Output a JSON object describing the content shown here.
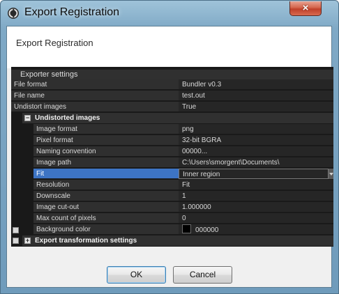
{
  "window": {
    "title": "Export Registration",
    "close_glyph": "×"
  },
  "header": {
    "title": "Export Registration"
  },
  "grid": {
    "group_title": "Exporter settings",
    "top_rows": [
      {
        "label": "File format",
        "value": "Bundler v0.3"
      },
      {
        "label": "File name",
        "value": "test.out"
      },
      {
        "label": "Undistort images",
        "value": "True"
      }
    ],
    "undistorted_section": {
      "label": "Undistorted images",
      "expander": "−"
    },
    "sub_rows": [
      {
        "label": "Image format",
        "value": "png"
      },
      {
        "label": "Pixel format",
        "value": "32-bit BGRA"
      },
      {
        "label": "Naming convention",
        "value": "00000..."
      },
      {
        "label": "Image path",
        "value": "C:\\Users\\smorgent\\Documents\\"
      },
      {
        "label": "Fit",
        "value": "Inner region",
        "selected": true
      },
      {
        "label": "Resolution",
        "value": "Fit"
      },
      {
        "label": "Downscale",
        "value": "1"
      },
      {
        "label": "Image cut-out",
        "value": "1.000000"
      },
      {
        "label": "Max count of pixels",
        "value": "0"
      },
      {
        "label": "Background color",
        "value": "000000",
        "color": "#000000"
      }
    ],
    "transform_section": {
      "label": "Export transformation settings",
      "expander": "+"
    }
  },
  "buttons": {
    "ok": "OK",
    "cancel": "Cancel"
  },
  "colors": {
    "selection": "#3d74c4",
    "grid_bg": "#191919",
    "ok_border": "#3c7fb1"
  }
}
